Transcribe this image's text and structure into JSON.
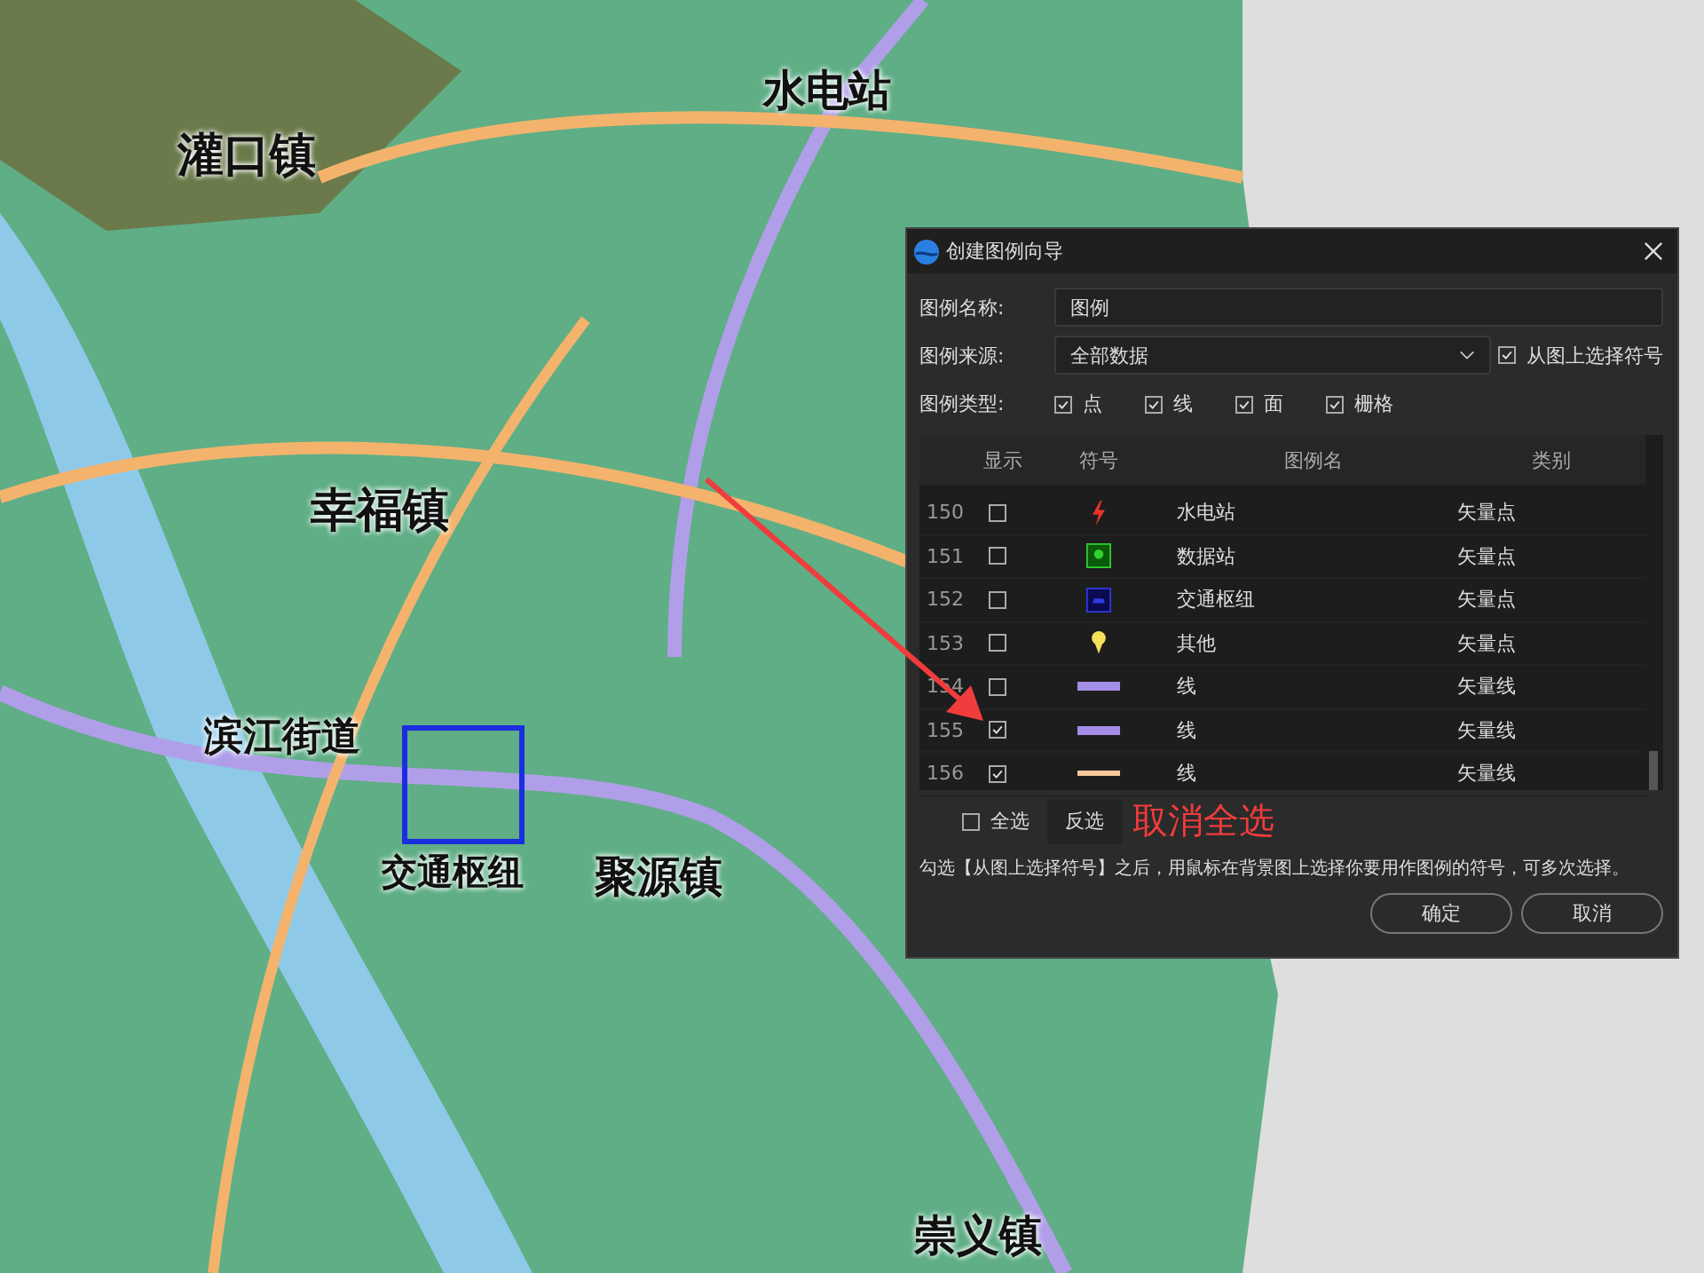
{
  "map": {
    "labels": [
      "灌口镇",
      "水电站",
      "幸福镇",
      "滨江街道",
      "交通枢纽",
      "聚源镇",
      "崇义镇"
    ]
  },
  "dialog": {
    "title": "创建图例向导",
    "fields": [
      {
        "kind": "text",
        "label": "图例名称:",
        "value": "图例"
      },
      {
        "kind": "select",
        "label": "图例来源:",
        "value": "全部数据",
        "option": {
          "label": "从图上选择符号",
          "checked": true
        }
      }
    ],
    "types": {
      "label": "图例类型:",
      "items": [
        {
          "label": "点",
          "checked": true
        },
        {
          "label": "线",
          "checked": true
        },
        {
          "label": "面",
          "checked": true
        },
        {
          "label": "栅格",
          "checked": true
        }
      ]
    },
    "table": {
      "columns": [
        "显示",
        "符号",
        "图例名",
        "类别"
      ],
      "rows": [
        {
          "index": "150",
          "checked": false,
          "kind": "bolt",
          "name": "水电站",
          "category": "矢量点"
        },
        {
          "index": "151",
          "checked": false,
          "kind": "green-box",
          "name": "数据站",
          "category": "矢量点"
        },
        {
          "index": "152",
          "checked": false,
          "kind": "blue-box",
          "name": "交通枢纽",
          "category": "矢量点"
        },
        {
          "index": "153",
          "checked": false,
          "kind": "pin",
          "name": "其他",
          "category": "矢量点"
        },
        {
          "index": "154",
          "checked": false,
          "kind": "line",
          "color": "#a48de6",
          "name": "线",
          "category": "矢量线"
        },
        {
          "index": "155",
          "checked": true,
          "kind": "line",
          "color": "#a48de6",
          "name": "线",
          "category": "矢量线"
        },
        {
          "index": "156",
          "checked": true,
          "kind": "thin-line",
          "color": "#f6c79a",
          "name": "线",
          "category": "矢量线"
        }
      ]
    },
    "select_all": {
      "label": "全选",
      "checked": false
    },
    "invert_button": "反选",
    "hint": "勾选【从图上选择符号】之后，用鼠标在背景图上选择你要用作图例的符号，可多次选择。",
    "buttons": [
      "确定",
      "取消"
    ]
  },
  "annotation": {
    "text": "取消全选"
  }
}
